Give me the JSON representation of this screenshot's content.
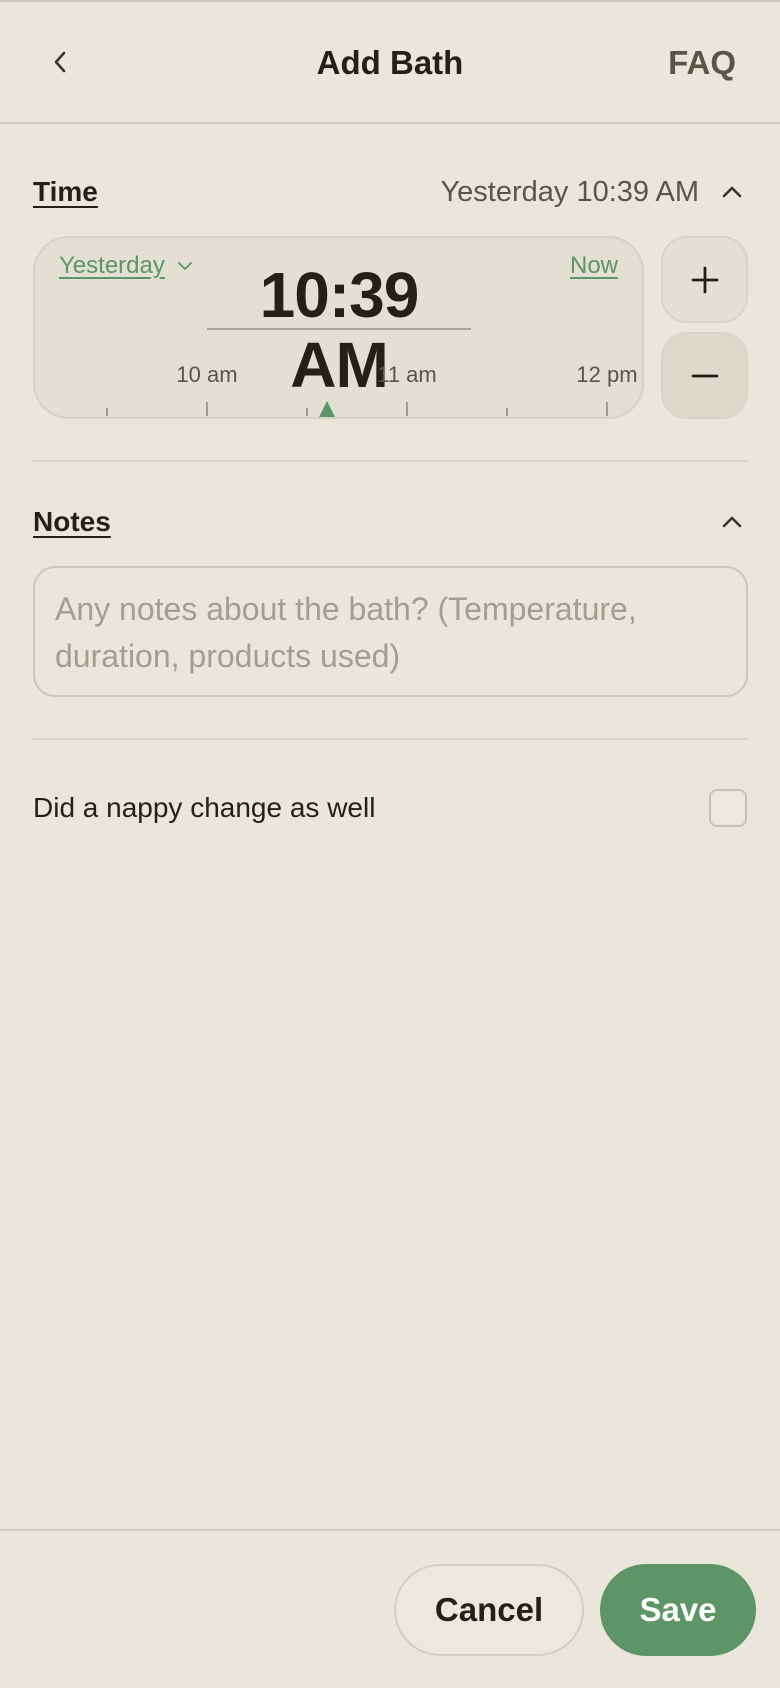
{
  "header": {
    "back_icon": "chevron-left-icon",
    "title": "Add Bath",
    "faq_label": "FAQ"
  },
  "time_section": {
    "title": "Time",
    "summary": "Yesterday 10:39 AM",
    "day_selected": "Yesterday",
    "now_label": "Now",
    "time_value": "10:39 AM",
    "timeline_labels": [
      "10 am",
      "11 am",
      "12 pm"
    ],
    "plus_label": "+",
    "minus_label": "−"
  },
  "notes_section": {
    "title": "Notes",
    "placeholder": "Any notes about the bath? (Temperature, duration, products used)",
    "value": ""
  },
  "nappy_change": {
    "label": "Did a nappy change as well",
    "checked": false
  },
  "footer": {
    "cancel_label": "Cancel",
    "save_label": "Save"
  },
  "colors": {
    "background": "#EAE6DB",
    "accent": "#5E9566",
    "text": "#231F19",
    "muted": "#5B5549"
  }
}
